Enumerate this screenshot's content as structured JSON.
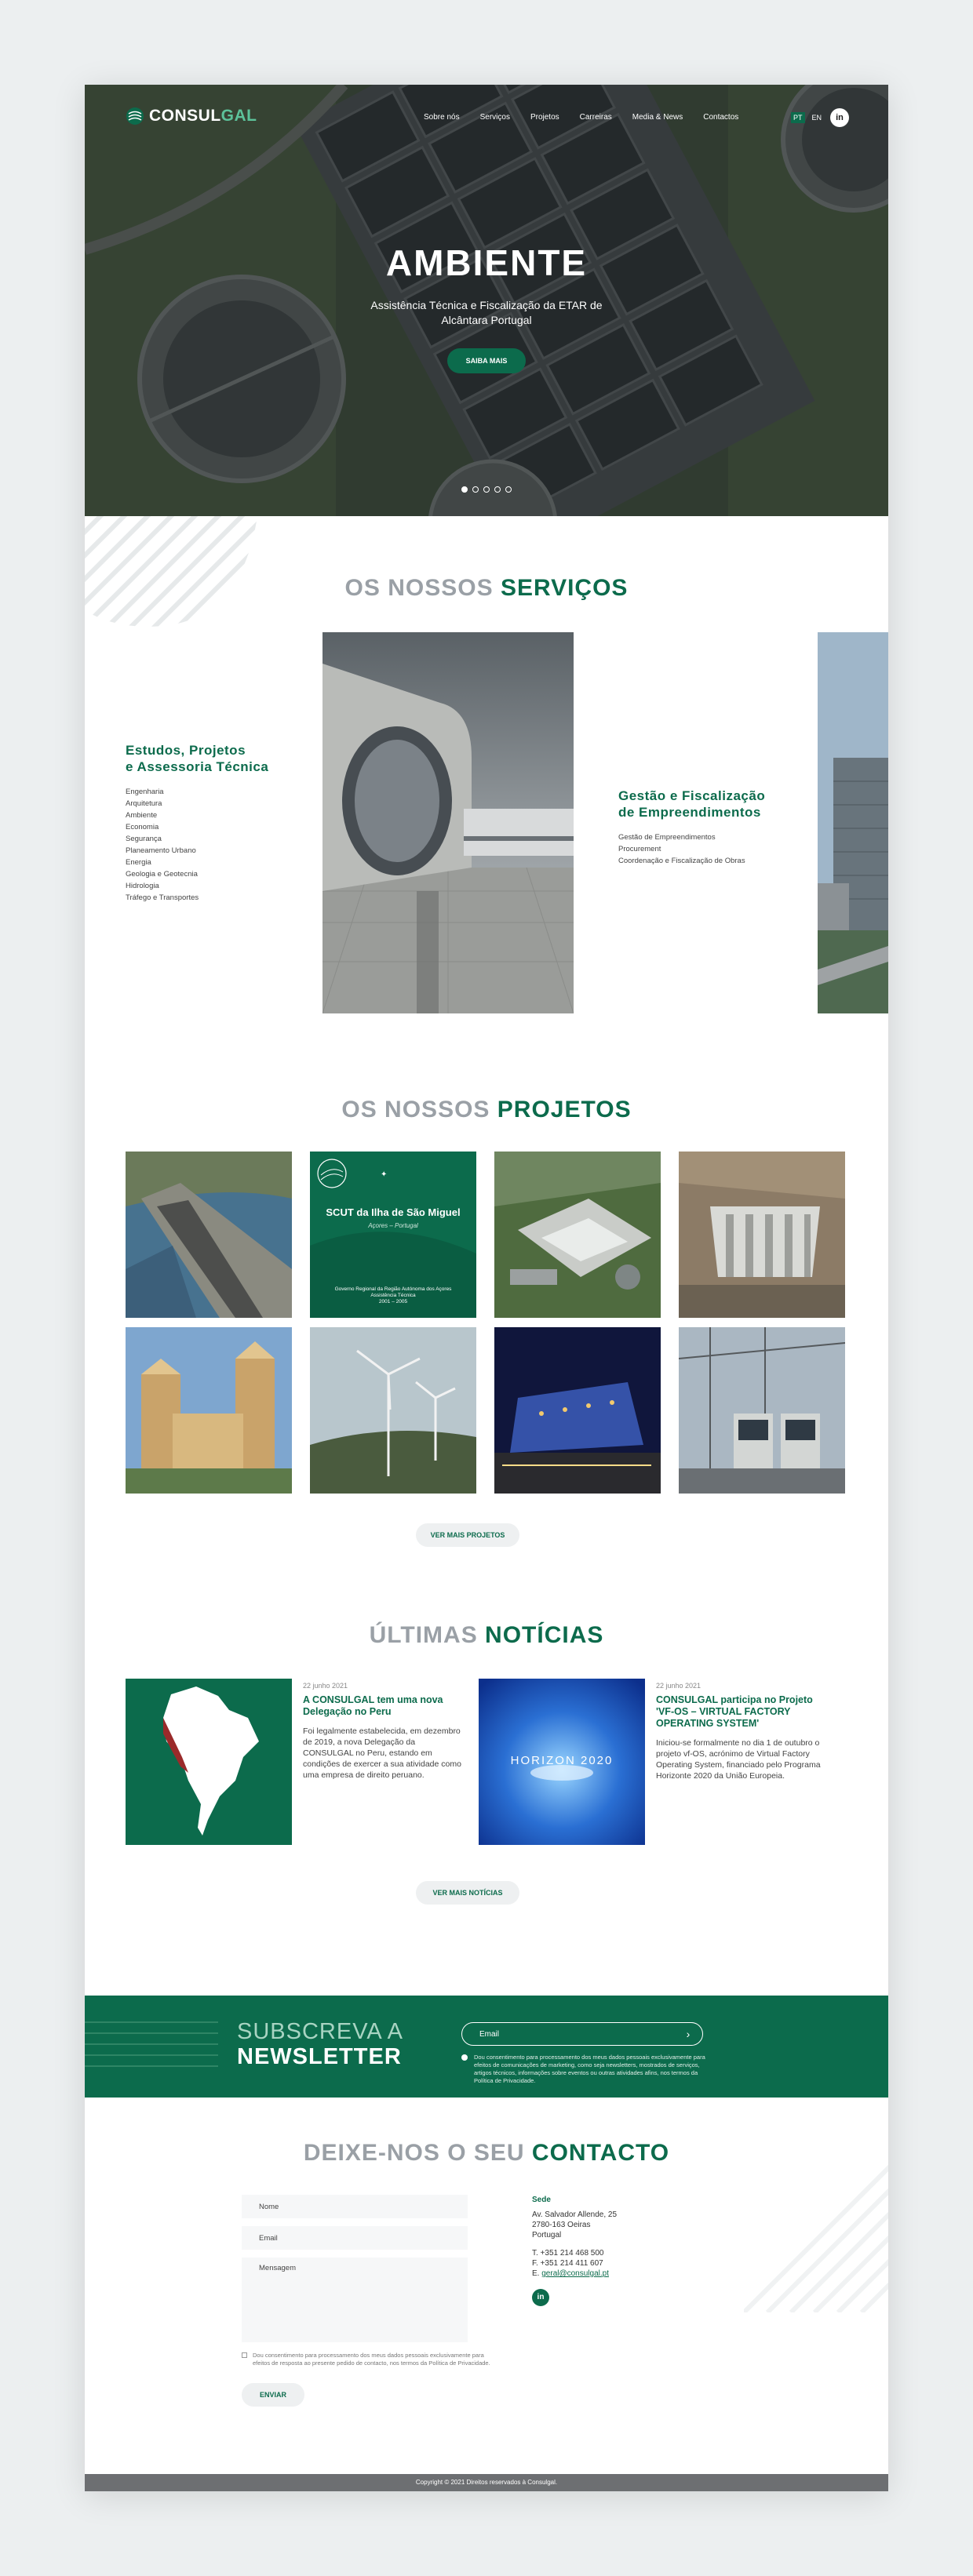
{
  "brand": {
    "name_part1": "CONSUL",
    "name_part2": "GAL",
    "accent": "#0c6b4c"
  },
  "nav": {
    "links": [
      "Sobre nós",
      "Serviços",
      "Projetos",
      "Carreiras",
      "Media & News",
      "Contactos"
    ],
    "lang_active": "PT",
    "lang_other": "EN",
    "social": "in"
  },
  "hero": {
    "title": "AMBIENTE",
    "subtitle": "Assistência Técnica e Fiscalização da ETAR de Alcântara Portugal",
    "button": "SAIBA MAIS",
    "slides": 5,
    "active_slide": 1
  },
  "services": {
    "title_light": "OS NOSSOS ",
    "title_bold": "SERVIÇOS",
    "left": {
      "title": "Estudos, Projetos\ne Assessoria Técnica",
      "items": [
        "Engenharia",
        "Arquitetura",
        "Ambiente",
        "Economia",
        "Segurança",
        "Planeamento Urbano",
        "Energia",
        "Geologia e Geotecnia",
        "Hidrologia",
        "Tráfego e Transportes"
      ]
    },
    "right": {
      "title": "Gestão e Fiscalização\nde Empreendimentos",
      "items": [
        "Gestão de Empreendimentos",
        "Procurement",
        "Coordenação e Fiscalização de Obras"
      ]
    }
  },
  "projects": {
    "title_light": "OS NOSSOS ",
    "title_bold": "PROJETOS",
    "featured_card": {
      "title": "SCUT da Ilha de São Miguel",
      "subtitle": "Açores – Portugal",
      "line1": "Governo Regional da Região Autónoma dos Açores",
      "line2": "Assistência Técnica",
      "line3": "2001 – 2005"
    },
    "button": "VER MAIS PROJETOS"
  },
  "news": {
    "title_light": "ÚLTIMAS ",
    "title_bold": "NOTÍCIAS",
    "items": [
      {
        "date": "22 junho 2021",
        "title": "A CONSULGAL tem uma nova Delegação no Peru",
        "body": "Foi legalmente estabelecida, em dezembro de 2019, a nova Delegação da CONSULGAL no Peru, estando em condições de exercer a sua atividade como uma empresa de direito peruano."
      },
      {
        "date": "22 junho 2021",
        "title": "CONSULGAL participa no Projeto 'VF-OS – VIRTUAL FACTORY OPERATING SYSTEM'",
        "body": "Iniciou-se formalmente no dia 1 de outubro o projeto vf-OS, acrónimo de Virtual Factory Operating System, financiado pelo Programa Horizonte 2020 da União Europeia.",
        "image_text": "HORIZON 2020"
      }
    ],
    "button": "VER MAIS NOTÍCIAS"
  },
  "newsletter": {
    "title_line1": "SUBSCREVA A",
    "title_line2": "NEWSLETTER",
    "placeholder": "Email",
    "consent": "Dou consentimento para processamento dos meus dados pessoais exclusivamente para efeitos de comunicações de marketing, como seja newsletters, mostrados de serviços, artigos técnicos, informações sobre eventos ou outras atividades afins, nos termos da Política de Privacidade."
  },
  "contact": {
    "title_light": "DEIXE-NOS O SEU ",
    "title_bold": "CONTACTO",
    "name_placeholder": "Nome",
    "email_placeholder": "Email",
    "message_placeholder": "Mensagem",
    "consent": "Dou consentimento para processamento dos meus dados pessoais exclusivamente para efeitos de resposta ao presente pedido de contacto, nos termos da Política de Privacidade.",
    "submit": "ENVIAR",
    "hq_label": "Sede",
    "address1": "Av. Salvador Allende, 25",
    "address2": "2780-163 Oeiras",
    "address3": "Portugal",
    "phone": "T. +351 214 468 500",
    "fax": "F. +351 214 411 607",
    "email_label": "E. ",
    "email": "geral@consulgal.pt",
    "social": "in"
  },
  "footer": {
    "text": "Copyright © 2021 Direitos reservados à Consulgal."
  }
}
